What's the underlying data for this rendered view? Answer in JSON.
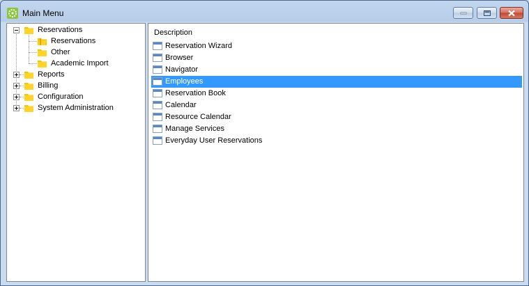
{
  "window": {
    "title": "Main Menu"
  },
  "tree": {
    "items": [
      {
        "label": "Reservations",
        "expanded": true,
        "children": [
          {
            "label": "Reservations"
          },
          {
            "label": "Other"
          },
          {
            "label": "Academic Import"
          }
        ]
      },
      {
        "label": "Reports",
        "expanded": false
      },
      {
        "label": "Billing",
        "expanded": false
      },
      {
        "label": "Configuration",
        "expanded": false
      },
      {
        "label": "System Administration",
        "expanded": false
      }
    ]
  },
  "list": {
    "header": "Description",
    "selected_index": 3,
    "items": [
      "Reservation Wizard",
      "Browser",
      "Navigator",
      "Employees",
      "Reservation Book",
      "Calendar",
      "Resource Calendar",
      "Manage Services",
      "Everyday User Reservations"
    ]
  },
  "colors": {
    "selection": "#3399ff",
    "folder": "#f5c400",
    "close_button": "#c34630"
  }
}
